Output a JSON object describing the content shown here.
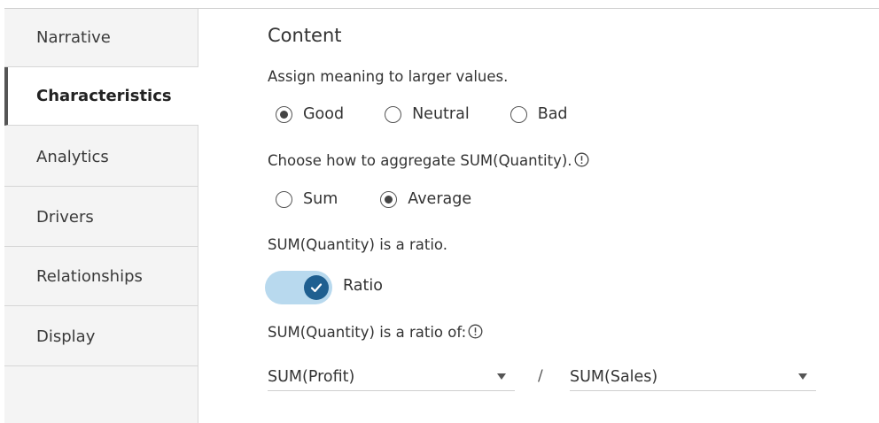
{
  "sidebar": {
    "items": [
      {
        "label": "Narrative"
      },
      {
        "label": "Characteristics",
        "active": true
      },
      {
        "label": "Analytics"
      },
      {
        "label": "Drivers"
      },
      {
        "label": "Relationships"
      },
      {
        "label": "Display"
      }
    ]
  },
  "content": {
    "title": "Content",
    "meaning": {
      "prompt": "Assign meaning to larger values.",
      "options": [
        "Good",
        "Neutral",
        "Bad"
      ],
      "selected": "Good"
    },
    "aggregate": {
      "prompt": "Choose how to aggregate SUM(Quantity).",
      "options": [
        "Sum",
        "Average"
      ],
      "selected": "Average"
    },
    "ratio": {
      "prompt": "SUM(Quantity) is a ratio.",
      "toggle_label": "Ratio",
      "toggle_on": true
    },
    "ratio_of": {
      "prompt": "SUM(Quantity) is a ratio of:",
      "numerator": "SUM(Profit)",
      "separator": "/",
      "denominator": "SUM(Sales)"
    }
  },
  "colors": {
    "accent": "#1f5f90",
    "toggle_track": "#b8d9ee",
    "sidebar_bg": "#f4f4f4"
  },
  "icons": {
    "info": "info-circle-icon",
    "check": "check-icon",
    "dropdown": "chevron-down-icon"
  }
}
